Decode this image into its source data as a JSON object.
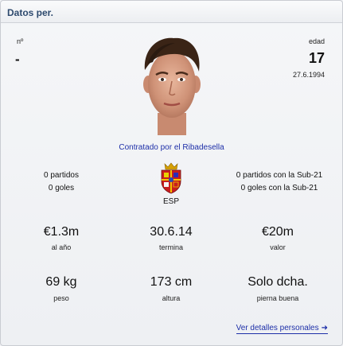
{
  "panel": {
    "title": "Datos per."
  },
  "number": {
    "label": "nº",
    "value": "-"
  },
  "age": {
    "label": "edad",
    "value": "17",
    "birthdate": "27.6.1994"
  },
  "contract_text": "Contratado por el Ribadesella",
  "national": {
    "caps": "0 partidos",
    "goals": "0 goles",
    "u21_caps": "0 partidos con la Sub-21",
    "u21_goals": "0 goles con la Sub-21",
    "nation_code": "ESP"
  },
  "finance": {
    "wage": "€1.3m",
    "wage_label": "al año",
    "expires": "30.6.14",
    "expires_label": "termina",
    "value": "€20m",
    "value_label": "valor"
  },
  "physical": {
    "weight": "69 kg",
    "weight_label": "peso",
    "height": "173 cm",
    "height_label": "altura",
    "foot": "Solo dcha.",
    "foot_label": "pierna buena"
  },
  "link": {
    "details": "Ver detalles personales"
  },
  "icons": {
    "arrow": "arrow-right-icon",
    "crest": "spain-crest-icon"
  },
  "colors": {
    "link": "#1d2fa8",
    "title": "#2e4a6e"
  }
}
